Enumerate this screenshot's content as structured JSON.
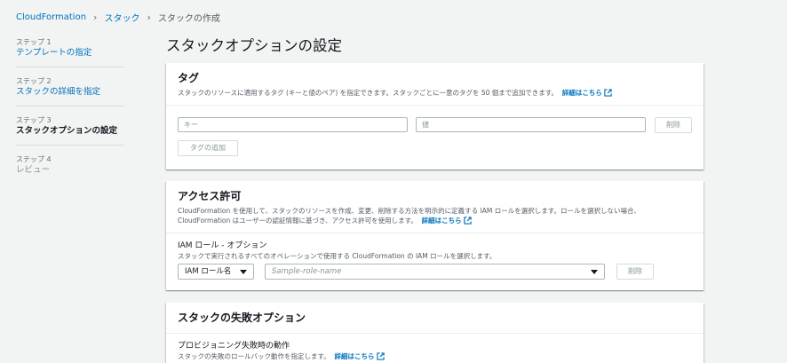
{
  "breadcrumb": {
    "items": [
      "CloudFormation",
      "スタック",
      "スタックの作成"
    ]
  },
  "sidebar": {
    "steps": [
      {
        "num": "ステップ 1",
        "label": "テンプレートの指定"
      },
      {
        "num": "ステップ 2",
        "label": "スタックの詳細を指定"
      },
      {
        "num": "ステップ 3",
        "label": "スタックオプションの設定"
      },
      {
        "num": "ステップ 4",
        "label": "レビュー"
      }
    ]
  },
  "page": {
    "title": "スタックオプションの設定"
  },
  "tags": {
    "title": "タグ",
    "description": "スタックのリソースに適用するタグ (キーと値のペア) を指定できます。スタックごとに一意のタグを 50 個まで追加できます。",
    "info_link": "詳細はこちら",
    "key_placeholder": "キー",
    "value_placeholder": "値",
    "remove_button": "削除",
    "add_button": "タグの追加"
  },
  "permissions": {
    "title": "アクセス許可",
    "description": "CloudFormation を使用して、スタックのリソースを作成、変更、削除する方法を明示的に定義する IAM ロールを選択します。ロールを選択しない場合、CloudFormation はユーザーの認証情報に基づき、アクセス許可を使用します。",
    "info_link": "詳細はこちら",
    "iam_label": "IAM ロール - オプション",
    "iam_desc": "スタックで実行されるすべてのオペレーションで使用する CloudFormation の IAM ロールを選択します。",
    "iam_type_select": "IAM ロール名",
    "role_placeholder": "Sample-role-name",
    "remove_button": "削除"
  },
  "failure": {
    "title": "スタックの失敗オプション",
    "provision_label": "プロビジョニング失敗時の動作",
    "provision_desc": "スタックの失敗のロールバック動作を指定します。",
    "info_link": "詳細はこちら"
  },
  "colors": {
    "link": "#0073bb",
    "background": "#f2f3f3",
    "panel": "#ffffff"
  }
}
